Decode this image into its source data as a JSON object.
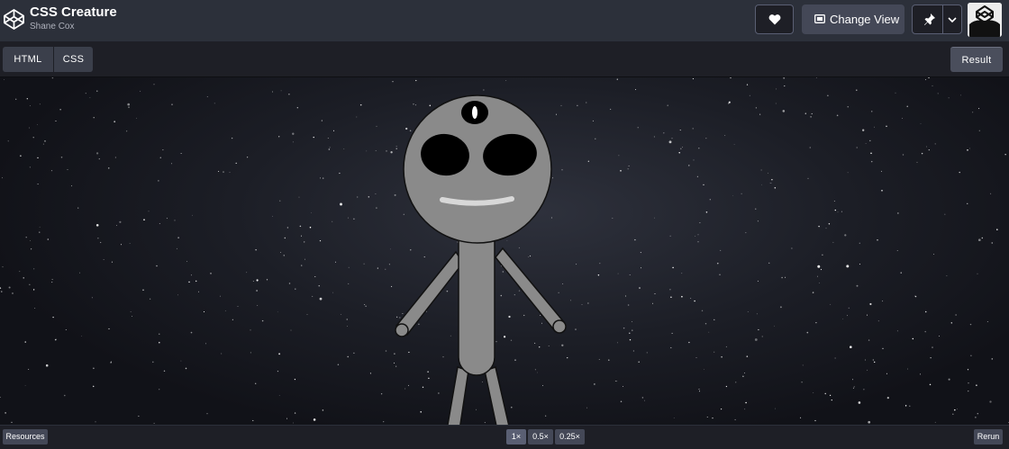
{
  "header": {
    "title": "CSS Creature",
    "author": "Shane Cox",
    "change_view_label": "Change View"
  },
  "editor_tabs": {
    "html": "HTML",
    "css": "CSS",
    "result": "Result"
  },
  "footer": {
    "resources_label": "Resources",
    "zoom_options": [
      "1×",
      "0.5×",
      "0.25×"
    ],
    "active_zoom": "1×",
    "rerun_label": "Rerun"
  },
  "icons": {
    "logo": "codepen-logo-icon",
    "heart": "heart-icon",
    "change_view": "change-view-icon",
    "pin": "pin-icon",
    "chevron": "chevron-down-icon"
  },
  "colors": {
    "header_bg": "#2c303a",
    "button_bg": "#444857",
    "creature_gray": "#8a8a8a",
    "space_bg": "#1c1e26"
  }
}
